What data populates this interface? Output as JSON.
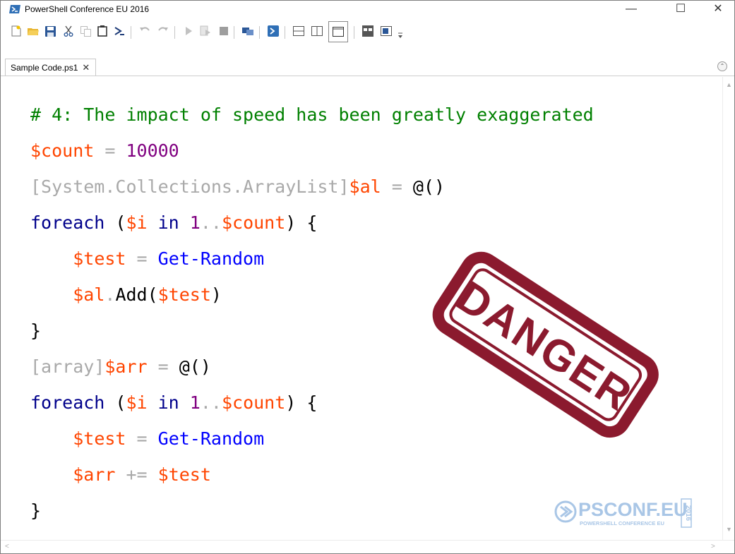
{
  "window": {
    "title": "PowerShell Conference EU 2016",
    "controls": {
      "minimize": "—",
      "maximize": "☐",
      "close": "✕"
    }
  },
  "toolbar": {
    "buttons": [
      "new-icon",
      "open-icon",
      "save-icon",
      "cut-icon",
      "copy-icon",
      "paste-icon",
      "console-icon",
      "undo-icon",
      "redo-icon",
      "run-icon",
      "run-selection-icon",
      "stop-icon",
      "remote-tab-icon",
      "powershell-icon",
      "layout-top-icon",
      "layout-right-icon",
      "layout-max-icon",
      "show-commands-icon",
      "show-addon-icon",
      "overflow-icon"
    ]
  },
  "tabs": [
    {
      "label": "Sample Code.ps1",
      "close": "✕",
      "active": true
    }
  ],
  "editor": {
    "lines": [
      [
        {
          "t": "# 4: The impact of speed has been greatly exaggerated",
          "c": "cm"
        }
      ],
      [
        {
          "t": "$count",
          "c": "var"
        },
        {
          "t": " = ",
          "c": "op"
        },
        {
          "t": "10000",
          "c": "num"
        }
      ],
      [
        {
          "t": "[System.Collections.ArrayList]",
          "c": "type"
        },
        {
          "t": "$al",
          "c": "var"
        },
        {
          "t": " = ",
          "c": "op"
        },
        {
          "t": "@()",
          "c": "pun"
        }
      ],
      [
        {
          "t": "foreach",
          "c": "kw"
        },
        {
          "t": " (",
          "c": "pun"
        },
        {
          "t": "$i",
          "c": "var"
        },
        {
          "t": " in ",
          "c": "kw"
        },
        {
          "t": "1",
          "c": "num"
        },
        {
          "t": "..",
          "c": "op"
        },
        {
          "t": "$count",
          "c": "var"
        },
        {
          "t": ") {",
          "c": "pun"
        }
      ],
      [
        {
          "t": "    ",
          "c": "pun"
        },
        {
          "t": "$test",
          "c": "var"
        },
        {
          "t": " = ",
          "c": "op"
        },
        {
          "t": "Get-Random",
          "c": "cmd"
        }
      ],
      [
        {
          "t": "    ",
          "c": "pun"
        },
        {
          "t": "$al",
          "c": "var"
        },
        {
          "t": ".",
          "c": "op"
        },
        {
          "t": "Add",
          "c": "mem"
        },
        {
          "t": "(",
          "c": "pun"
        },
        {
          "t": "$test",
          "c": "var"
        },
        {
          "t": ")",
          "c": "pun"
        }
      ],
      [
        {
          "t": "}",
          "c": "pun"
        }
      ],
      [
        {
          "t": "[array]",
          "c": "type"
        },
        {
          "t": "$arr",
          "c": "var"
        },
        {
          "t": " = ",
          "c": "op"
        },
        {
          "t": "@()",
          "c": "pun"
        }
      ],
      [
        {
          "t": "foreach",
          "c": "kw"
        },
        {
          "t": " (",
          "c": "pun"
        },
        {
          "t": "$i",
          "c": "var"
        },
        {
          "t": " in ",
          "c": "kw"
        },
        {
          "t": "1",
          "c": "num"
        },
        {
          "t": "..",
          "c": "op"
        },
        {
          "t": "$count",
          "c": "var"
        },
        {
          "t": ") {",
          "c": "pun"
        }
      ],
      [
        {
          "t": "    ",
          "c": "pun"
        },
        {
          "t": "$test",
          "c": "var"
        },
        {
          "t": " = ",
          "c": "op"
        },
        {
          "t": "Get-Random",
          "c": "cmd"
        }
      ],
      [
        {
          "t": "    ",
          "c": "pun"
        },
        {
          "t": "$arr",
          "c": "var"
        },
        {
          "t": " += ",
          "c": "op"
        },
        {
          "t": "$test",
          "c": "var"
        }
      ],
      [
        {
          "t": "}",
          "c": "pun"
        }
      ]
    ]
  },
  "overlays": {
    "stamp": {
      "text": "DANGER",
      "color": "#8b1a2e"
    },
    "logo": {
      "text": "PSCONF.EU",
      "subtext": "POWERSHELL CONFERENCE EU",
      "year": "2016",
      "color": "#a9c6e6"
    }
  },
  "colors": {
    "comment": "#008000",
    "variable": "#ff4500",
    "number": "#800080",
    "operator": "#a9a9a9",
    "keyword": "#00008b",
    "command": "#0000ff"
  }
}
